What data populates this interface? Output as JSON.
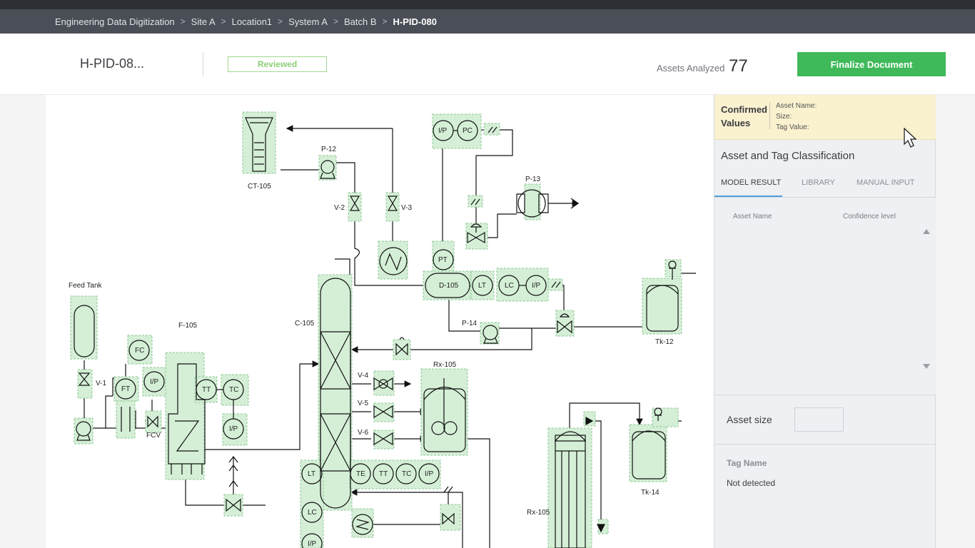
{
  "breadcrumb": {
    "items": [
      "Engineering Data Digitization",
      "Site A",
      "Location1",
      "System A",
      "Batch B"
    ],
    "current": "H-PID-080",
    "separator": ">"
  },
  "header": {
    "doc_title": "H-PID-08...",
    "status": "Reviewed",
    "assets_label": "Assets Analyzed",
    "assets_count": "77",
    "finalize_label": "Finalize Document"
  },
  "diagram": {
    "labels": {
      "feed_tank": "Feed Tank",
      "f105": "F-105",
      "c105": "C-105",
      "ct105": "CT-105",
      "p12": "P-12",
      "p13": "P-13",
      "p14": "P-14",
      "v1": "V-1",
      "v2": "V-2",
      "v3": "V-3",
      "v4": "V-4",
      "v5": "V-5",
      "v6": "V-6",
      "fcv": "FCV",
      "d105": "D-105",
      "rx105_top": "Rx-105",
      "rx105_bottom": "Rx-105",
      "tk12": "Tk-12",
      "tk14": "Tk-14"
    },
    "instruments": {
      "ip_a": "I/P",
      "pc": "PC",
      "pt": "PT",
      "lt_a": "LT",
      "lc_a": "LC",
      "ip_b": "I/P",
      "fc": "FC",
      "ft": "FT",
      "ip_c": "I/P",
      "tt_a": "TT",
      "tc_a": "TC",
      "ip_d": "I/P",
      "lt_b": "LT",
      "te": "TE",
      "tt_b": "TT",
      "tc_b": "TC",
      "ip_e": "I/P",
      "lc_b": "LC",
      "ip_f": "I/P"
    }
  },
  "panel": {
    "confirmed_title_1": "Confirmed",
    "confirmed_title_2": "Values",
    "fields": [
      "Asset Name:",
      "Size:",
      "Tag Value:"
    ],
    "classification_title": "Asset and Tag Classification",
    "tabs": [
      "MODEL RESULT",
      "LIBRARY",
      "MANUAL INPUT"
    ],
    "col_asset": "Asset Name",
    "col_confidence": "Confidence level",
    "asset_size_label": "Asset size",
    "tag_name_label": "Tag Name",
    "tag_name_value": "Not detected"
  },
  "colors": {
    "accent_green": "#3fb95a",
    "reviewed_green": "#8ccf78",
    "highlight_fill": "#d4efd6",
    "tab_blue": "#4fa0dc",
    "confirmed_bg": "#faf1cf"
  }
}
